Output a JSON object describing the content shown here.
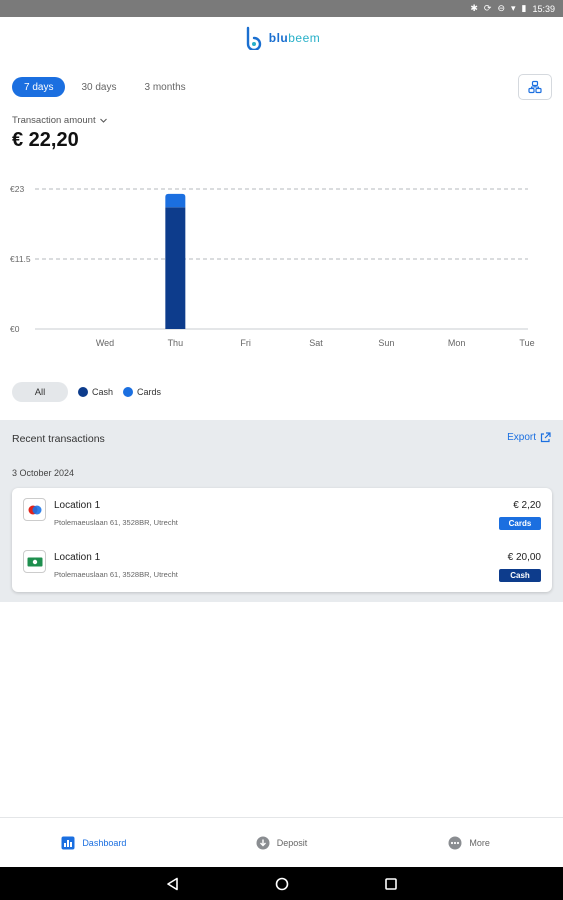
{
  "status_bar": {
    "time": "15:39"
  },
  "app": {
    "logo_primary": "blu",
    "logo_secondary": "beem"
  },
  "range_tabs": [
    {
      "label": "7 days",
      "active": true
    },
    {
      "label": "30 days",
      "active": false
    },
    {
      "label": "3 months",
      "active": false
    }
  ],
  "metric": {
    "label": "Transaction amount",
    "value": "€ 22,20"
  },
  "chart_data": {
    "type": "bar",
    "categories": [
      "Wed",
      "Thu",
      "Fri",
      "Sat",
      "Sun",
      "Mon",
      "Tue"
    ],
    "series": [
      {
        "name": "Cash",
        "color": "#0d3c8c",
        "values": [
          0,
          20.0,
          0,
          0,
          0,
          0,
          0
        ]
      },
      {
        "name": "Cards",
        "color": "#1b6fe0",
        "values": [
          0,
          2.2,
          0,
          0,
          0,
          0,
          0
        ]
      }
    ],
    "stacked": true,
    "ylim": [
      0,
      23
    ],
    "yticks": [
      0,
      11.5,
      23
    ],
    "ytick_labels": [
      "€0",
      "€11.5",
      "€23"
    ],
    "grid": "dashed-horizontal"
  },
  "legend": {
    "all_label": "All",
    "items": [
      {
        "label": "Cash",
        "color": "#0d3c8c"
      },
      {
        "label": "Cards",
        "color": "#1b6fe0"
      }
    ]
  },
  "recent": {
    "title": "Recent transactions",
    "export_label": "Export",
    "groups": [
      {
        "date": "3 October 2024",
        "transactions": [
          {
            "name": "Location 1",
            "address": "Ptolemaeuslaan 61, 3528BR, Utrecht",
            "amount": "€ 2,20",
            "method": "Cards",
            "icon": "card-payment-icon",
            "badge_color": "#1b6fe0"
          },
          {
            "name": "Location 1",
            "address": "Ptolemaeuslaan 61, 3528BR, Utrecht",
            "amount": "€ 20,00",
            "method": "Cash",
            "icon": "cash-icon",
            "badge_color": "#0d3c8c"
          }
        ]
      }
    ]
  },
  "bottom_nav": [
    {
      "label": "Dashboard",
      "icon": "dashboard-icon",
      "active": true
    },
    {
      "label": "Deposit",
      "icon": "deposit-icon",
      "active": false
    },
    {
      "label": "More",
      "icon": "more-icon",
      "active": false
    }
  ],
  "colors": {
    "accent": "#1b6fe0",
    "dark_blue": "#0d3c8c",
    "section_bg": "#e8ebee"
  }
}
